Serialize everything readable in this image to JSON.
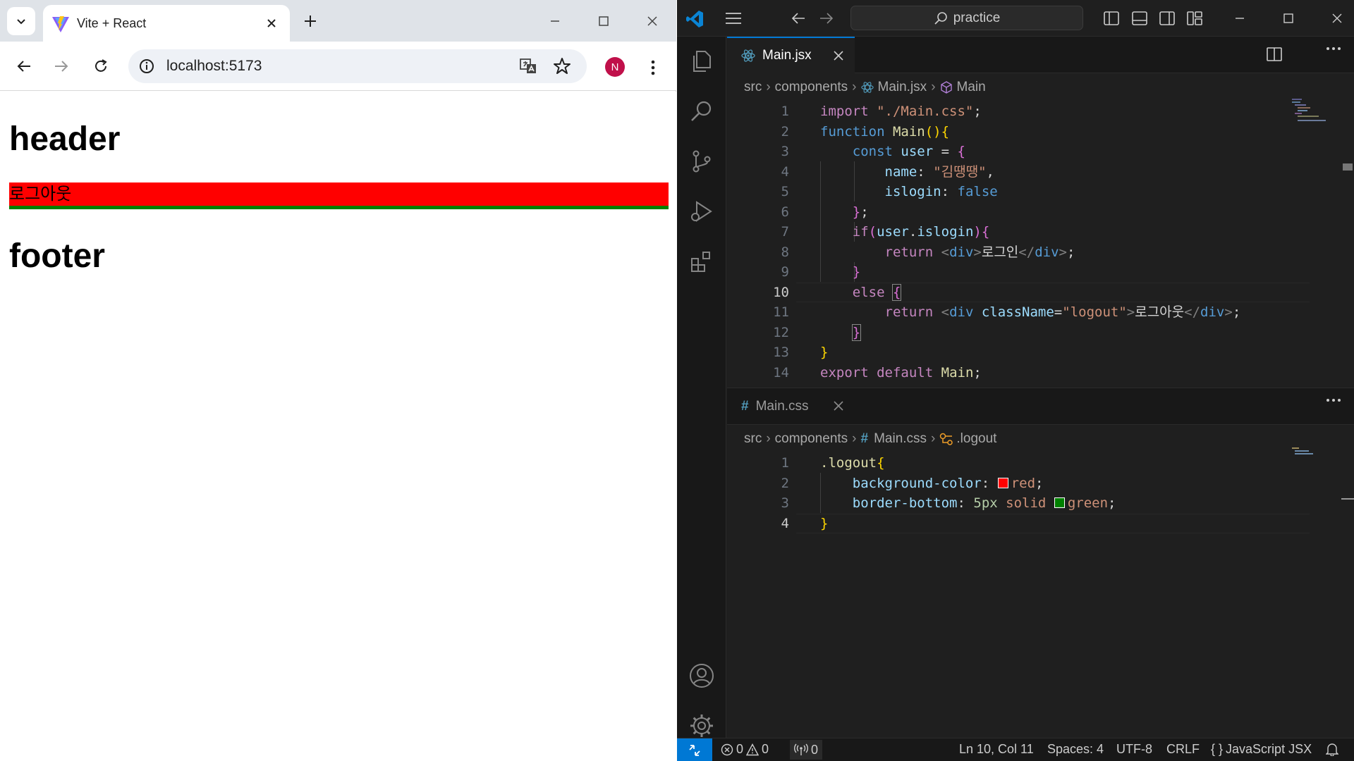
{
  "browser": {
    "tab_title": "Vite + React",
    "url": "localhost:5173",
    "profile_initial": "N",
    "page": {
      "header_text": "header",
      "logout_text": "로그아웃",
      "footer_text": "footer"
    }
  },
  "vscode": {
    "search_text": "practice",
    "editor1": {
      "tab_label": "Main.jsx",
      "breadcrumb": [
        "src",
        "components",
        "Main.jsx",
        "Main"
      ],
      "lines": [
        "import \"./Main.css\";",
        "function Main(){",
        "    const user = {",
        "        name: \"김땡땡\",",
        "        islogin: false",
        "    };",
        "    if(user.islogin){",
        "        return <div>로그인</div>;",
        "    }",
        "    else {",
        "        return <div className=\"logout\">로그아웃</div>;",
        "    }",
        "}",
        "export default Main;"
      ],
      "line_numbers": [
        "1",
        "2",
        "3",
        "4",
        "5",
        "6",
        "7",
        "8",
        "9",
        "10",
        "11",
        "12",
        "13",
        "14"
      ]
    },
    "editor2": {
      "tab_label": "Main.css",
      "breadcrumb": [
        "src",
        "components",
        "Main.css",
        ".logout"
      ],
      "lines": [
        ".logout{",
        "    background-color: red;",
        "    border-bottom: 5px solid green;",
        "}"
      ],
      "line_numbers": [
        "1",
        "2",
        "3",
        "4"
      ]
    },
    "status": {
      "errors": "0",
      "warnings": "0",
      "ports": "0",
      "cursor": "Ln 10, Col 11",
      "spaces": "Spaces: 4",
      "encoding": "UTF-8",
      "eol": "CRLF",
      "language": "JavaScript JSX"
    },
    "colors": {
      "accent": "#0078d4",
      "swatch_red": "#ff0000",
      "swatch_green": "#008000"
    }
  }
}
